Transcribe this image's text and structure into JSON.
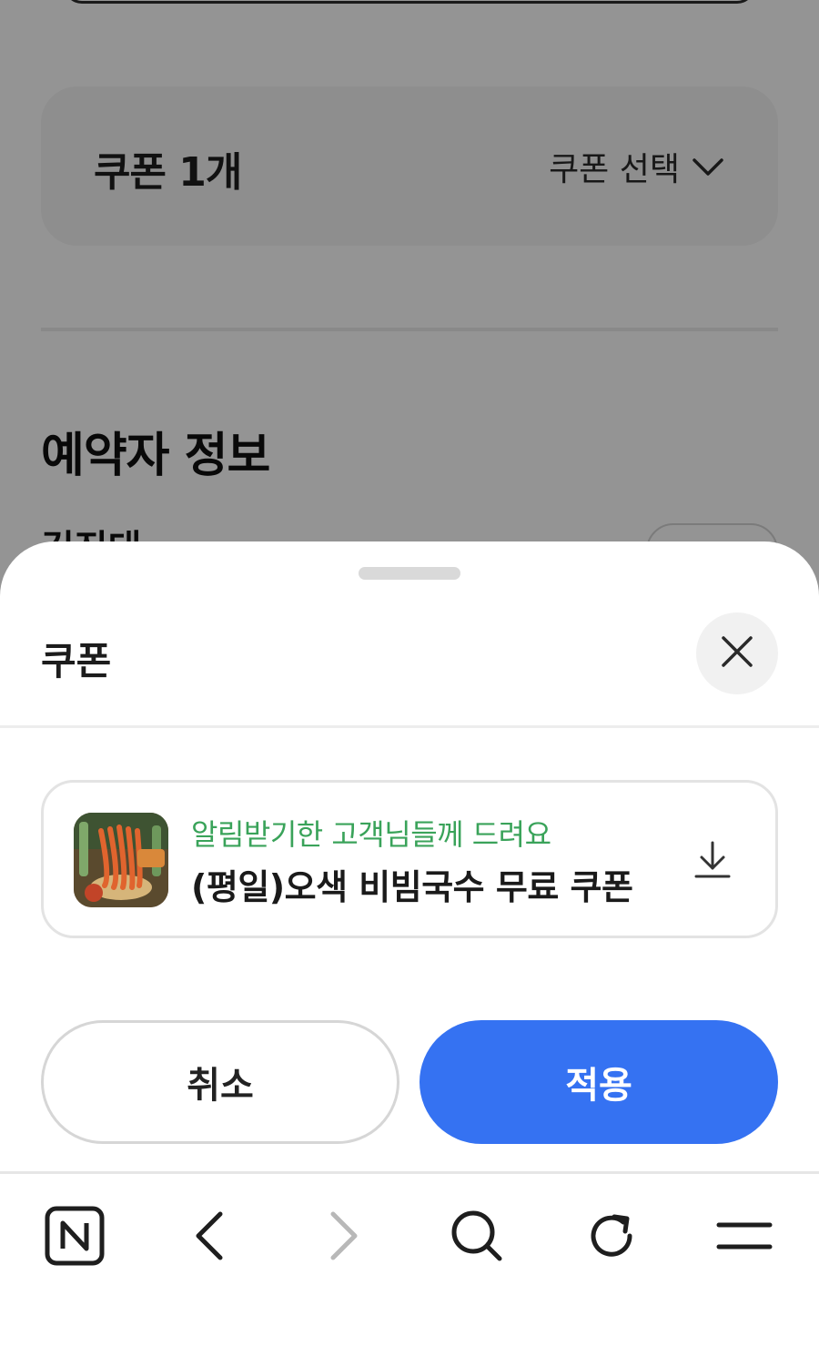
{
  "background_page": {
    "coupon_count_label": "쿠폰 1개",
    "coupon_select_label": "쿠폰 선택",
    "reserver_section_title": "예약자 정보",
    "reserver_name_partial": "김진대"
  },
  "sheet": {
    "title": "쿠폰",
    "coupons": [
      {
        "subtitle": "알림받기한 고객님들께 드려요",
        "name": "(평일)오색 비빔국수 무료 쿠폰",
        "thumbnail": "noodle-dish-image",
        "action_icon": "download-icon"
      }
    ],
    "cancel_label": "취소",
    "apply_label": "적용"
  },
  "browser_toolbar": {
    "items": [
      "naver-home-icon",
      "back-icon",
      "forward-icon",
      "search-icon",
      "refresh-icon",
      "menu-icon"
    ]
  },
  "colors": {
    "accent_blue": "#3572f2",
    "subtitle_green": "#3aa35a",
    "overlay": "rgba(0,0,0,0.42)"
  }
}
